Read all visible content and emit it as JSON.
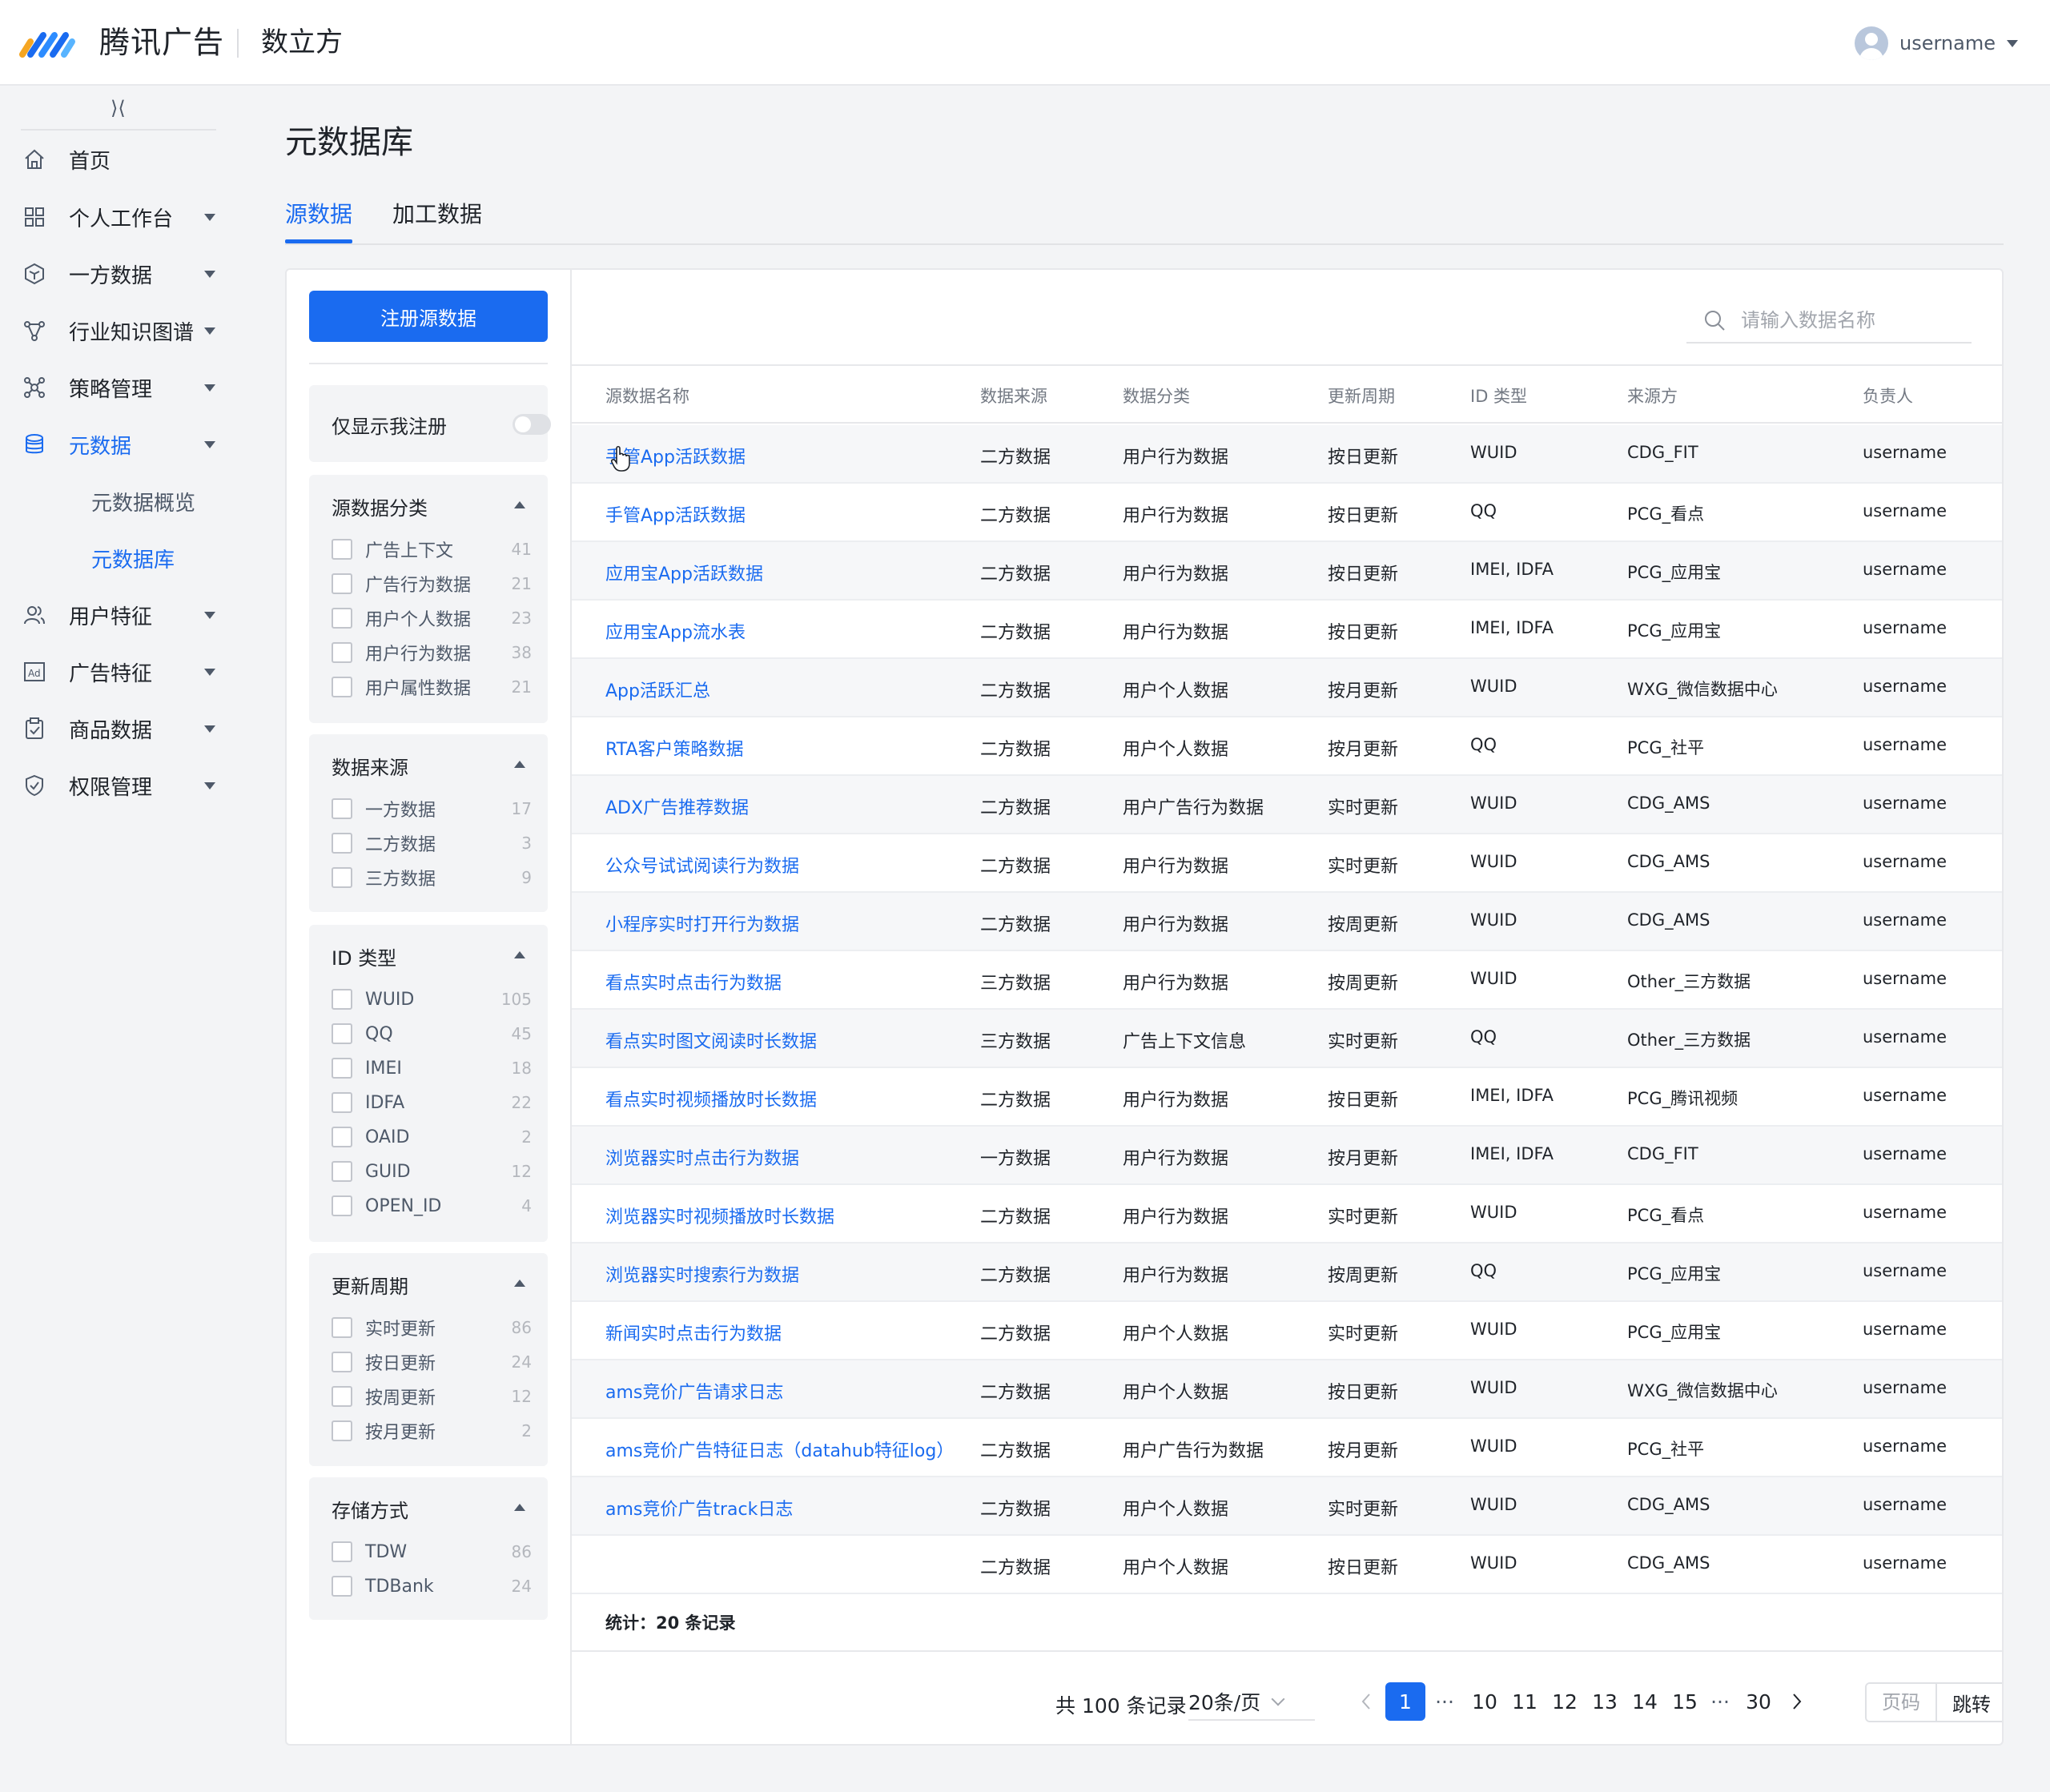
{
  "header": {
    "brand": "腾讯广告",
    "product": "数立方",
    "username": "username",
    "colors": {
      "primary": "#1a6bf0"
    }
  },
  "sidebar": {
    "collapse_glyph": "⟩⟨",
    "items": [
      {
        "label": "首页",
        "icon": "home-icon"
      },
      {
        "label": "个人工作台",
        "icon": "grid-icon"
      },
      {
        "label": "一方数据",
        "icon": "cube-icon"
      },
      {
        "label": "行业知识图谱",
        "icon": "graph-icon"
      },
      {
        "label": "策略管理",
        "icon": "strategy-icon"
      },
      {
        "label": "元数据",
        "icon": "database-icon"
      },
      {
        "label": "元数据概览"
      },
      {
        "label": "元数据库"
      },
      {
        "label": "用户特征",
        "icon": "users-icon"
      },
      {
        "label": "广告特征",
        "icon": "ad-icon"
      },
      {
        "label": "商品数据",
        "icon": "clipboard-icon"
      },
      {
        "label": "权限管理",
        "icon": "shield-icon"
      }
    ]
  },
  "page": {
    "title": "元数据库",
    "tabs": [
      "源数据",
      "加工数据"
    ]
  },
  "filters": {
    "register_button": "注册源数据",
    "only_mine": "仅显示我注册",
    "groups": [
      {
        "title": "源数据分类",
        "items": [
          {
            "name": "广告上下文",
            "count": "41"
          },
          {
            "name": "广告行为数据",
            "count": "21"
          },
          {
            "name": "用户个人数据",
            "count": "23"
          },
          {
            "name": "用户行为数据",
            "count": "38"
          },
          {
            "name": "用户属性数据",
            "count": "21"
          }
        ]
      },
      {
        "title": "数据来源",
        "items": [
          {
            "name": "一方数据",
            "count": "17"
          },
          {
            "name": "二方数据",
            "count": "3"
          },
          {
            "name": "三方数据",
            "count": "9"
          }
        ]
      },
      {
        "title": "ID 类型",
        "items": [
          {
            "name": "WUID",
            "count": "105"
          },
          {
            "name": "QQ",
            "count": "45"
          },
          {
            "name": "IMEI",
            "count": "18"
          },
          {
            "name": "IDFA",
            "count": "22"
          },
          {
            "name": "OAID",
            "count": "2"
          },
          {
            "name": "GUID",
            "count": "12"
          },
          {
            "name": "OPEN_ID",
            "count": "4"
          }
        ]
      },
      {
        "title": "更新周期",
        "items": [
          {
            "name": "实时更新",
            "count": "86"
          },
          {
            "name": "按日更新",
            "count": "24"
          },
          {
            "name": "按周更新",
            "count": "12"
          },
          {
            "name": "按月更新",
            "count": "2"
          }
        ]
      },
      {
        "title": "存储方式",
        "items": [
          {
            "name": "TDW",
            "count": "86"
          },
          {
            "name": "TDBank",
            "count": "24"
          }
        ]
      }
    ]
  },
  "table": {
    "search_placeholder": "请输入数据名称",
    "columns": [
      "源数据名称",
      "数据来源",
      "数据分类",
      "更新周期",
      "ID 类型",
      "来源方",
      "负责人"
    ],
    "rows": [
      [
        "手管App活跃数据",
        "二方数据",
        "用户行为数据",
        "按日更新",
        "WUID",
        "CDG_FIT",
        "username"
      ],
      [
        "手管App活跃数据",
        "二方数据",
        "用户行为数据",
        "按日更新",
        "QQ",
        "PCG_看点",
        "username"
      ],
      [
        "应用宝App活跃数据",
        "二方数据",
        "用户行为数据",
        "按日更新",
        "IMEI, IDFA",
        "PCG_应用宝",
        "username"
      ],
      [
        "应用宝App流水表",
        "二方数据",
        "用户行为数据",
        "按日更新",
        "IMEI, IDFA",
        "PCG_应用宝",
        "username"
      ],
      [
        "App活跃汇总",
        "二方数据",
        "用户个人数据",
        "按月更新",
        "WUID",
        "WXG_微信数据中心",
        "username"
      ],
      [
        "RTA客户策略数据",
        "二方数据",
        "用户个人数据",
        "按月更新",
        "QQ",
        "PCG_社平",
        "username"
      ],
      [
        "ADX广告推荐数据",
        "二方数据",
        "用户广告行为数据",
        "实时更新",
        "WUID",
        "CDG_AMS",
        "username"
      ],
      [
        "公众号试试阅读行为数据",
        "二方数据",
        "用户行为数据",
        "实时更新",
        "WUID",
        "CDG_AMS",
        "username"
      ],
      [
        "小程序实时打开行为数据",
        "二方数据",
        "用户行为数据",
        "按周更新",
        "WUID",
        "CDG_AMS",
        "username"
      ],
      [
        "看点实时点击行为数据",
        "三方数据",
        "用户行为数据",
        "按周更新",
        "WUID",
        "Other_三方数据",
        "username"
      ],
      [
        "看点实时图文阅读时长数据",
        "三方数据",
        "广告上下文信息",
        "实时更新",
        "QQ",
        "Other_三方数据",
        "username"
      ],
      [
        "看点实时视频播放时长数据",
        "二方数据",
        "用户行为数据",
        "按日更新",
        "IMEI, IDFA",
        "PCG_腾讯视频",
        "username"
      ],
      [
        "浏览器实时点击行为数据",
        "一方数据",
        "用户行为数据",
        "按月更新",
        "IMEI, IDFA",
        "CDG_FIT",
        "username"
      ],
      [
        "浏览器实时视频播放时长数据",
        "二方数据",
        "用户行为数据",
        "实时更新",
        "WUID",
        "PCG_看点",
        "username"
      ],
      [
        "浏览器实时搜索行为数据",
        "二方数据",
        "用户行为数据",
        "按周更新",
        "QQ",
        "PCG_应用宝",
        "username"
      ],
      [
        "新闻实时点击行为数据",
        "二方数据",
        "用户个人数据",
        "实时更新",
        "WUID",
        "PCG_应用宝",
        "username"
      ],
      [
        "ams竞价广告请求日志",
        "二方数据",
        "用户个人数据",
        "按日更新",
        "WUID",
        "WXG_微信数据中心",
        "username"
      ],
      [
        "ams竞价广告特征日志（datahub特征log）",
        "二方数据",
        "用户广告行为数据",
        "按月更新",
        "WUID",
        "PCG_社平",
        "username"
      ],
      [
        "ams竞价广告track日志",
        "二方数据",
        "用户个人数据",
        "实时更新",
        "WUID",
        "CDG_AMS",
        "username"
      ],
      [
        "",
        "二方数据",
        "用户个人数据",
        "按日更新",
        "WUID",
        "CDG_AMS",
        "username"
      ]
    ],
    "stats": "统计：20 条记录"
  },
  "pagination": {
    "total": "共 100 条记录",
    "page_size": "20条/页",
    "pages": [
      "1",
      "···",
      "10",
      "11",
      "12",
      "13",
      "14",
      "15",
      "···",
      "30"
    ],
    "jump_placeholder": "页码",
    "jump_button": "跳转"
  }
}
